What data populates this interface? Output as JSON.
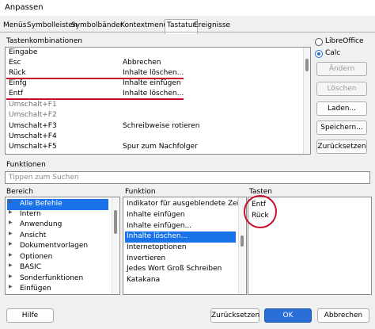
{
  "window": {
    "title": "Anpassen"
  },
  "tabs": [
    "Menüs",
    "Symbolleisten",
    "Symbolbänder",
    "Kontextmenüs",
    "Tastatur",
    "Ereignisse"
  ],
  "shortcuts": {
    "label": "Tastenkombinationen",
    "rows": [
      {
        "key": "Eingabe",
        "cmd": "",
        "dim": false
      },
      {
        "key": "Esc",
        "cmd": "Abbrechen",
        "dim": false
      },
      {
        "key": "Rück",
        "cmd": "Inhalte löschen...",
        "dim": false
      },
      {
        "key": "Einfg",
        "cmd": "Inhalte einfügen",
        "dim": false
      },
      {
        "key": "Entf",
        "cmd": "Inhalte löschen...",
        "dim": false
      },
      {
        "key": "Umschalt+F1",
        "cmd": "",
        "dim": true
      },
      {
        "key": "Umschalt+F2",
        "cmd": "",
        "dim": true
      },
      {
        "key": "Umschalt+F3",
        "cmd": "Schreibweise rotieren",
        "dim": false
      },
      {
        "key": "Umschalt+F4",
        "cmd": "",
        "dim": false
      },
      {
        "key": "Umschalt+F5",
        "cmd": "Spur zum Nachfolger",
        "dim": false
      }
    ]
  },
  "scope": {
    "libreoffice": "LibreOffice",
    "calc": "Calc",
    "selected": "Calc"
  },
  "side_buttons": {
    "modify": "Ändern",
    "delete": "Löschen",
    "load": "Laden...",
    "save": "Speichern...",
    "reset": "Zurücksetzen"
  },
  "functions": {
    "label": "Funktionen",
    "search_placeholder": "Tippen zum Suchen",
    "category_label": "Bereich",
    "function_label": "Funktion",
    "keys_label": "Tasten",
    "categories": [
      "Alle Befehle",
      "Intern",
      "Anwendung",
      "Ansicht",
      "Dokumentvorlagen",
      "Optionen",
      "BASIC",
      "Sonderfunktionen",
      "Einfügen"
    ],
    "selected_category": "Alle Befehle",
    "function_items": [
      "Indikator für ausgeblendete Zeilen/",
      "Inhalte einfügen",
      "Inhalte einfügen...",
      "Inhalte löschen...",
      "Internetoptionen",
      "Invertieren",
      "Jedes Wort Groß Schreiben",
      "Katakana"
    ],
    "selected_function": "Inhalte löschen...",
    "keys": [
      "Entf",
      "Rück"
    ]
  },
  "footer": {
    "help": "Hilfe",
    "reset": "Zurücksetzen",
    "ok": "OK",
    "cancel": "Abbrechen"
  },
  "colors": {
    "selection": "#1a73e8",
    "annotation": "#c8102e",
    "primary": "#2a6fd6"
  }
}
